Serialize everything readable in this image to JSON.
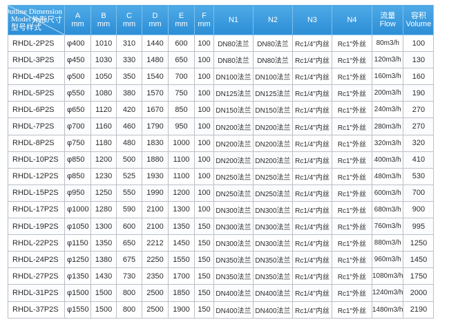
{
  "header": {
    "corner_en_top": "Outline Dimension",
    "corner_cn_top": "外形尺寸",
    "corner_en_bottom": "Model style",
    "corner_cn_bottom": "型号样式",
    "unit": "mm",
    "columns": [
      "A",
      "B",
      "C",
      "D",
      "E",
      "F",
      "N1",
      "N2",
      "N3",
      "N4"
    ],
    "flow_cn": "流量",
    "flow_en": "Flow",
    "volume_cn": "容积",
    "volume_en": "Volume"
  },
  "colors": {
    "header_bg": "#3a9ee0",
    "border": "#b9bec6"
  },
  "rows": [
    [
      "RHDL-2P2S",
      "φ400",
      "1010",
      "310",
      "1440",
      "600",
      "100",
      "DN80法兰",
      "DN80法兰",
      "Rc1/4\"内丝",
      "Rc1\"外丝",
      "80m3/h",
      "100"
    ],
    [
      "RHDL-3P2S",
      "φ450",
      "1030",
      "330",
      "1480",
      "650",
      "100",
      "DN80法兰",
      "DN80法兰",
      "Rc1/4\"内丝",
      "Rc1\"外丝",
      "120m3/h",
      "130"
    ],
    [
      "RHDL-4P2S",
      "φ500",
      "1050",
      "350",
      "1540",
      "700",
      "100",
      "DN100法兰",
      "DN100法兰",
      "Rc1/4\"内丝",
      "Rc1\"外丝",
      "160m3/h",
      "160"
    ],
    [
      "RHDL-5P2S",
      "φ550",
      "1080",
      "380",
      "1570",
      "750",
      "100",
      "DN125法兰",
      "DN125法兰",
      "Rc1/4\"内丝",
      "Rc1\"外丝",
      "200m3/h",
      "190"
    ],
    [
      "RHDL-6P2S",
      "φ650",
      "1120",
      "420",
      "1670",
      "850",
      "100",
      "DN150法兰",
      "DN150法兰",
      "Rc1/4\"内丝",
      "Rc1\"外丝",
      "240m3/h",
      "270"
    ],
    [
      "RHDL-7P2S",
      "φ700",
      "1160",
      "460",
      "1790",
      "950",
      "100",
      "DN200法兰",
      "DN200法兰",
      "Rc1/4\"内丝",
      "Rc1\"外丝",
      "280m3/h",
      "270"
    ],
    [
      "RHDL-8P2S",
      "φ750",
      "1180",
      "480",
      "1830",
      "1000",
      "100",
      "DN200法兰",
      "DN200法兰",
      "Rc1/4\"内丝",
      "Rc1\"外丝",
      "320m3/h",
      "320"
    ],
    [
      "RHDL-10P2S",
      "φ850",
      "1200",
      "500",
      "1880",
      "1100",
      "100",
      "DN200法兰",
      "DN200法兰",
      "Rc1/4\"内丝",
      "Rc1\"外丝",
      "400m3/h",
      "410"
    ],
    [
      "RHDL-12P2S",
      "φ850",
      "1230",
      "525",
      "1930",
      "1100",
      "100",
      "DN250法兰",
      "DN250法兰",
      "Rc1/4\"内丝",
      "Rc1\"外丝",
      "480m3/h",
      "530"
    ],
    [
      "RHDL-15P2S",
      "φ950",
      "1250",
      "550",
      "1990",
      "1200",
      "100",
      "DN250法兰",
      "DN250法兰",
      "Rc1/4\"内丝",
      "Rc1\"外丝",
      "600m3/h",
      "700"
    ],
    [
      "RHDL-17P2S",
      "φ1000",
      "1280",
      "590",
      "2100",
      "1300",
      "100",
      "DN300法兰",
      "DN300法兰",
      "Rc1/4\"内丝",
      "Rc1\"外丝",
      "680m3/h",
      "900"
    ],
    [
      "RHDL-19P2S",
      "φ1050",
      "1300",
      "600",
      "2100",
      "1350",
      "150",
      "DN300法兰",
      "DN300法兰",
      "Rc1/4\"内丝",
      "Rc1\"外丝",
      "760m3/h",
      "995"
    ],
    [
      "RHDL-22P2S",
      "φ1150",
      "1350",
      "650",
      "2212",
      "1450",
      "150",
      "DN300法兰",
      "DN300法兰",
      "Rc1/4\"内丝",
      "Rc1\"外丝",
      "880m3/h",
      "1250"
    ],
    [
      "RHDL-24P2S",
      "φ1250",
      "1380",
      "675",
      "2250",
      "1550",
      "150",
      "DN350法兰",
      "DN350法兰",
      "Rc1/4\"内丝",
      "Rc1\"外丝",
      "960m3/h",
      "1450"
    ],
    [
      "RHDL-27P2S",
      "φ1350",
      "1430",
      "730",
      "2350",
      "1700",
      "150",
      "DN350法兰",
      "DN350法兰",
      "Rc1/4\"内丝",
      "Rc1\"外丝",
      "1080m3/h",
      "1750"
    ],
    [
      "RHDL-31P2S",
      "φ1500",
      "1500",
      "800",
      "2500",
      "1850",
      "150",
      "DN400法兰",
      "DN400法兰",
      "Rc1/4\"内丝",
      "Rc1\"外丝",
      "1240m3/h",
      "2000"
    ],
    [
      "RHDL-37P2S",
      "φ1550",
      "1500",
      "800",
      "2500",
      "1900",
      "150",
      "DN400法兰",
      "DN400法兰",
      "Rc1/4\"内丝",
      "Rc1\"外丝",
      "1480m3/h",
      "2190"
    ]
  ]
}
